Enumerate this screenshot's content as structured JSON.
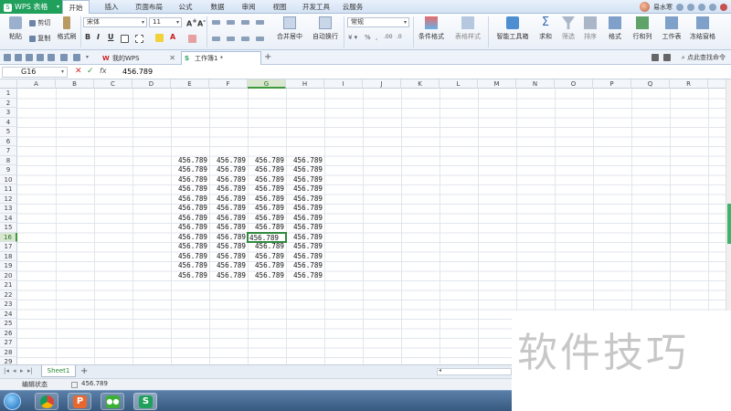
{
  "app": {
    "name": "WPS 表格"
  },
  "menu": {
    "items": [
      "开始",
      "插入",
      "页面布局",
      "公式",
      "数据",
      "审阅",
      "视图",
      "开发工具",
      "云服务"
    ],
    "active": "开始"
  },
  "user": {
    "name": "易水寒"
  },
  "ribbon": {
    "paste": "粘贴",
    "cut": "剪切",
    "copy": "复制",
    "format_painter": "格式刷",
    "font_name": "宋体",
    "font_size": "11",
    "bold": "B",
    "italic": "I",
    "underline": "U",
    "merge_center": "合并居中",
    "wrap_text": "自动换行",
    "number_format": "常规",
    "conditional_format": "条件格式",
    "table_style": "表格样式",
    "smart_toolbox": "智能工具箱",
    "sum": "求和",
    "filter": "筛选",
    "sort": "排序",
    "format": "格式",
    "row_col": "行和列",
    "worksheet": "工作表",
    "freeze": "冻结窗格"
  },
  "tabs": {
    "my_wps": "我的WPS",
    "workbook": "工作簿1 *",
    "search_cmd": "点此查找命令"
  },
  "formula_bar": {
    "name_box": "G16",
    "fx": "fx",
    "value": "456.789"
  },
  "grid": {
    "columns": [
      "A",
      "B",
      "C",
      "D",
      "E",
      "F",
      "G",
      "H",
      "I",
      "J",
      "K",
      "L",
      "M",
      "N",
      "O",
      "P",
      "Q",
      "R"
    ],
    "rows": [
      "1",
      "2",
      "3",
      "4",
      "5",
      "6",
      "7",
      "8",
      "9",
      "10",
      "11",
      "12",
      "13",
      "14",
      "15",
      "16",
      "17",
      "18",
      "19",
      "20",
      "21",
      "22",
      "23",
      "24",
      "25",
      "26",
      "27",
      "28",
      "29"
    ],
    "selected_column": "G",
    "selected_row": "16",
    "cell_value": "456.789",
    "filled_rows": [
      "8",
      "9",
      "10",
      "11",
      "12",
      "13",
      "14",
      "15",
      "16",
      "17",
      "18",
      "19",
      "20"
    ],
    "filled_columns": [
      "E",
      "F",
      "G",
      "H"
    ]
  },
  "sheets": {
    "active": "Sheet1"
  },
  "status": {
    "mode": "编辑状态",
    "value": "456.789"
  },
  "watermark": "软件技巧"
}
